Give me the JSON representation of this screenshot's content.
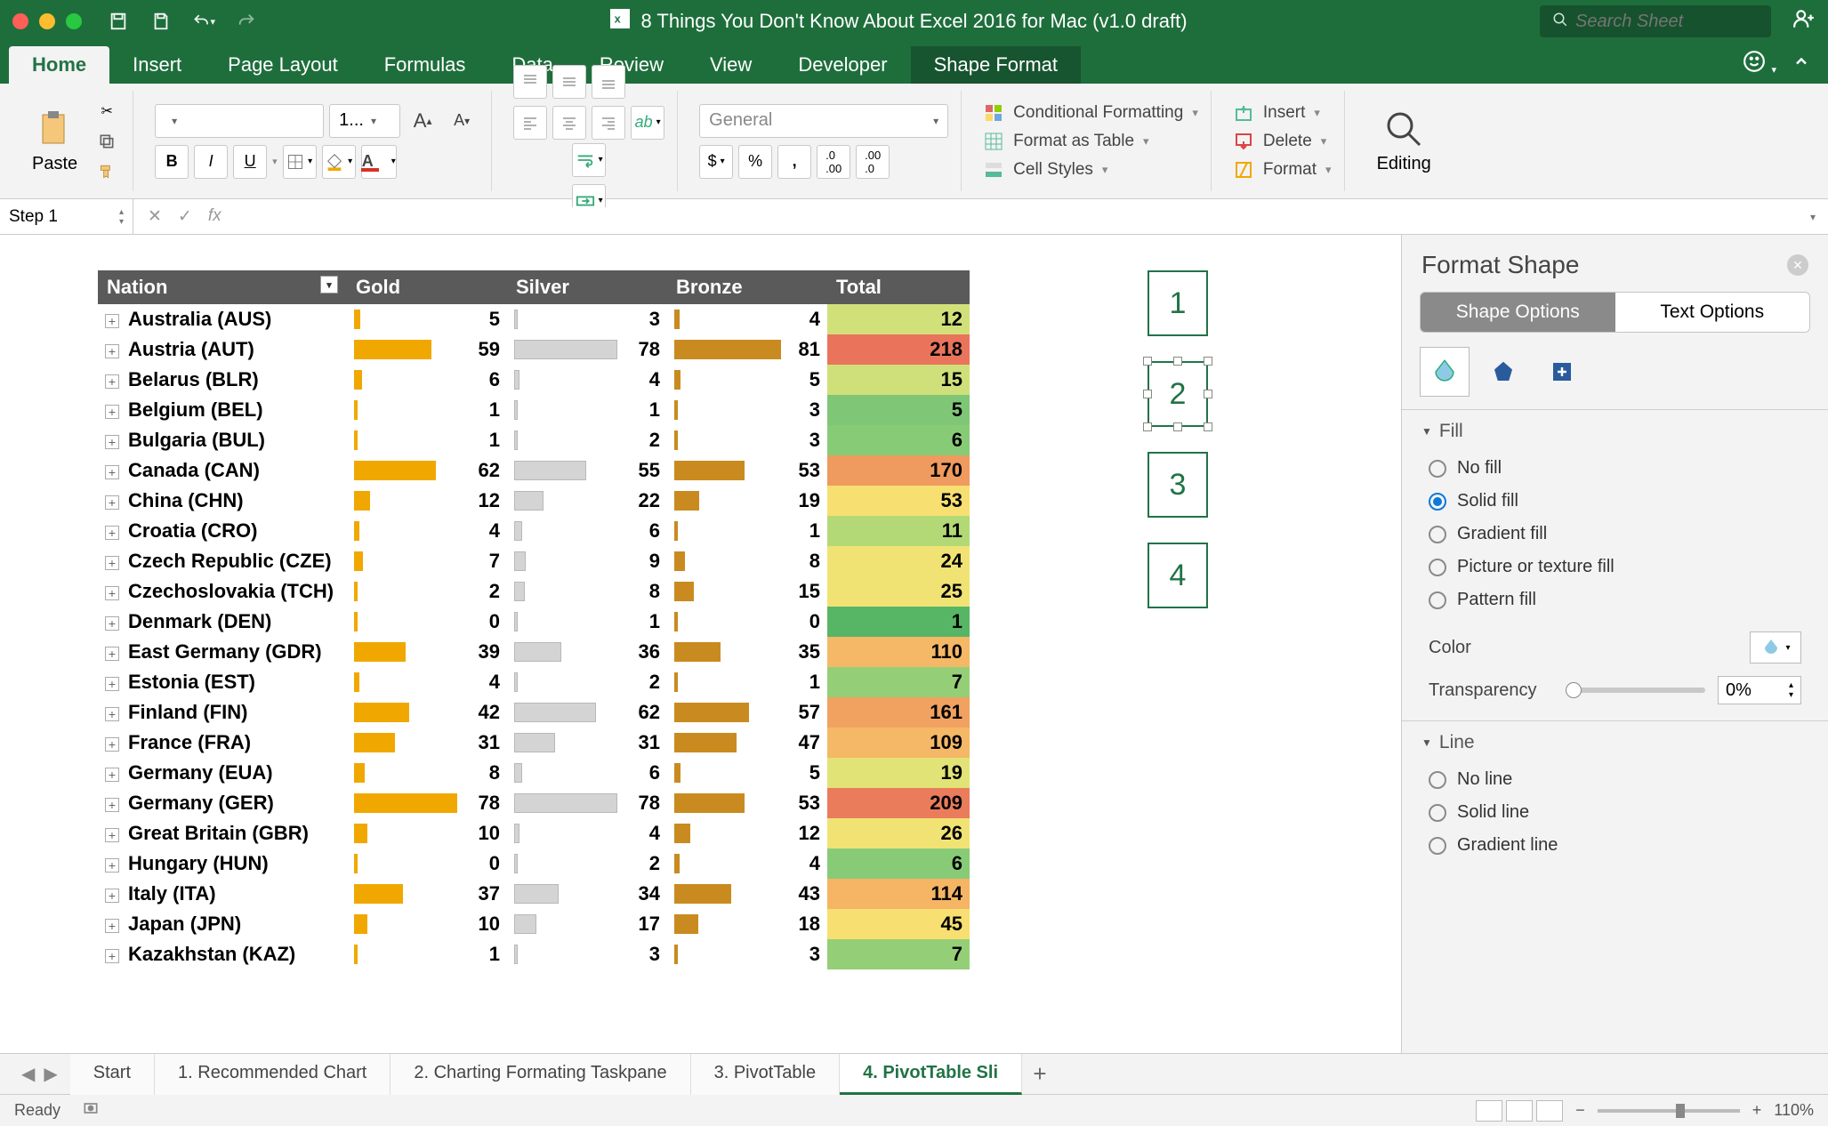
{
  "title": "8 Things You Don't Know About Excel 2016 for Mac (v1.0 draft)",
  "search_placeholder": "Search Sheet",
  "tabs": [
    "Home",
    "Insert",
    "Page Layout",
    "Formulas",
    "Data",
    "Review",
    "View",
    "Developer",
    "Shape Format"
  ],
  "tabs_active": 0,
  "tabs_context": 8,
  "ribbon": {
    "paste": "Paste",
    "font_name": "",
    "font_size": "1...",
    "bold": "B",
    "italic": "I",
    "underline": "U",
    "number_format": "General",
    "cond_fmt": "Conditional Formatting",
    "fmt_table": "Format as Table",
    "cell_styles": "Cell Styles",
    "insert": "Insert",
    "delete": "Delete",
    "format": "Format",
    "editing": "Editing"
  },
  "name_box": "Step 1",
  "formula": "",
  "pivot": {
    "headers": [
      "Nation",
      "Gold",
      "Silver",
      "Bronze",
      "Total"
    ],
    "rows": [
      {
        "n": "Australia (AUS)",
        "g": 5,
        "s": 3,
        "b": 4,
        "t": 12,
        "c": "#d2e07a"
      },
      {
        "n": "Austria (AUT)",
        "g": 59,
        "s": 78,
        "b": 81,
        "t": 218,
        "c": "#e9745b"
      },
      {
        "n": "Belarus (BLR)",
        "g": 6,
        "s": 4,
        "b": 5,
        "t": 15,
        "c": "#cfe07a"
      },
      {
        "n": "Belgium (BEL)",
        "g": 1,
        "s": 1,
        "b": 3,
        "t": 5,
        "c": "#7fc776"
      },
      {
        "n": "Bulgaria (BUL)",
        "g": 1,
        "s": 2,
        "b": 3,
        "t": 6,
        "c": "#88cb77"
      },
      {
        "n": "Canada (CAN)",
        "g": 62,
        "s": 55,
        "b": 53,
        "t": 170,
        "c": "#ef9a5f"
      },
      {
        "n": "China (CHN)",
        "g": 12,
        "s": 22,
        "b": 19,
        "t": 53,
        "c": "#f7df71"
      },
      {
        "n": "Croatia (CRO)",
        "g": 4,
        "s": 6,
        "b": 1,
        "t": 11,
        "c": "#b3d977"
      },
      {
        "n": "Czech Republic (CZE)",
        "g": 7,
        "s": 9,
        "b": 8,
        "t": 24,
        "c": "#f0e374"
      },
      {
        "n": "Czechoslovakia (TCH)",
        "g": 2,
        "s": 8,
        "b": 15,
        "t": 25,
        "c": "#f0e374"
      },
      {
        "n": "Denmark (DEN)",
        "g": 0,
        "s": 1,
        "b": 0,
        "t": 1,
        "c": "#57b566"
      },
      {
        "n": "East Germany (GDR)",
        "g": 39,
        "s": 36,
        "b": 35,
        "t": 110,
        "c": "#f5b866"
      },
      {
        "n": "Estonia (EST)",
        "g": 4,
        "s": 2,
        "b": 1,
        "t": 7,
        "c": "#94cf77"
      },
      {
        "n": "Finland (FIN)",
        "g": 42,
        "s": 62,
        "b": 57,
        "t": 161,
        "c": "#f1a260"
      },
      {
        "n": "France (FRA)",
        "g": 31,
        "s": 31,
        "b": 47,
        "t": 109,
        "c": "#f5b866"
      },
      {
        "n": "Germany (EUA)",
        "g": 8,
        "s": 6,
        "b": 5,
        "t": 19,
        "c": "#e1e376"
      },
      {
        "n": "Germany (GER)",
        "g": 78,
        "s": 78,
        "b": 53,
        "t": 209,
        "c": "#ea7c5c"
      },
      {
        "n": "Great Britain (GBR)",
        "g": 10,
        "s": 4,
        "b": 12,
        "t": 26,
        "c": "#f0e374"
      },
      {
        "n": "Hungary (HUN)",
        "g": 0,
        "s": 2,
        "b": 4,
        "t": 6,
        "c": "#88cb77"
      },
      {
        "n": "Italy (ITA)",
        "g": 37,
        "s": 34,
        "b": 43,
        "t": 114,
        "c": "#f5b565"
      },
      {
        "n": "Japan (JPN)",
        "g": 10,
        "s": 17,
        "b": 18,
        "t": 45,
        "c": "#f7df71"
      },
      {
        "n": "Kazakhstan (KAZ)",
        "g": 1,
        "s": 3,
        "b": 3,
        "t": 7,
        "c": "#94cf77"
      }
    ],
    "max": 81
  },
  "slicers": [
    "1",
    "2",
    "3",
    "4"
  ],
  "pane": {
    "title": "Format Shape",
    "tab1": "Shape Options",
    "tab2": "Text Options",
    "fill": "Fill",
    "fill_opts": [
      "No fill",
      "Solid fill",
      "Gradient fill",
      "Picture or texture fill",
      "Pattern fill"
    ],
    "fill_checked": 1,
    "color_lbl": "Color",
    "transp_lbl": "Transparency",
    "transp_val": "0%",
    "line": "Line",
    "line_opts": [
      "No line",
      "Solid line",
      "Gradient line"
    ]
  },
  "sheet_tabs": [
    "Start",
    "1. Recommended Chart",
    "2. Charting Formating Taskpane",
    "3. PivotTable",
    "4. PivotTable Sli"
  ],
  "sheet_active": 4,
  "status": "Ready",
  "zoom": "110%"
}
